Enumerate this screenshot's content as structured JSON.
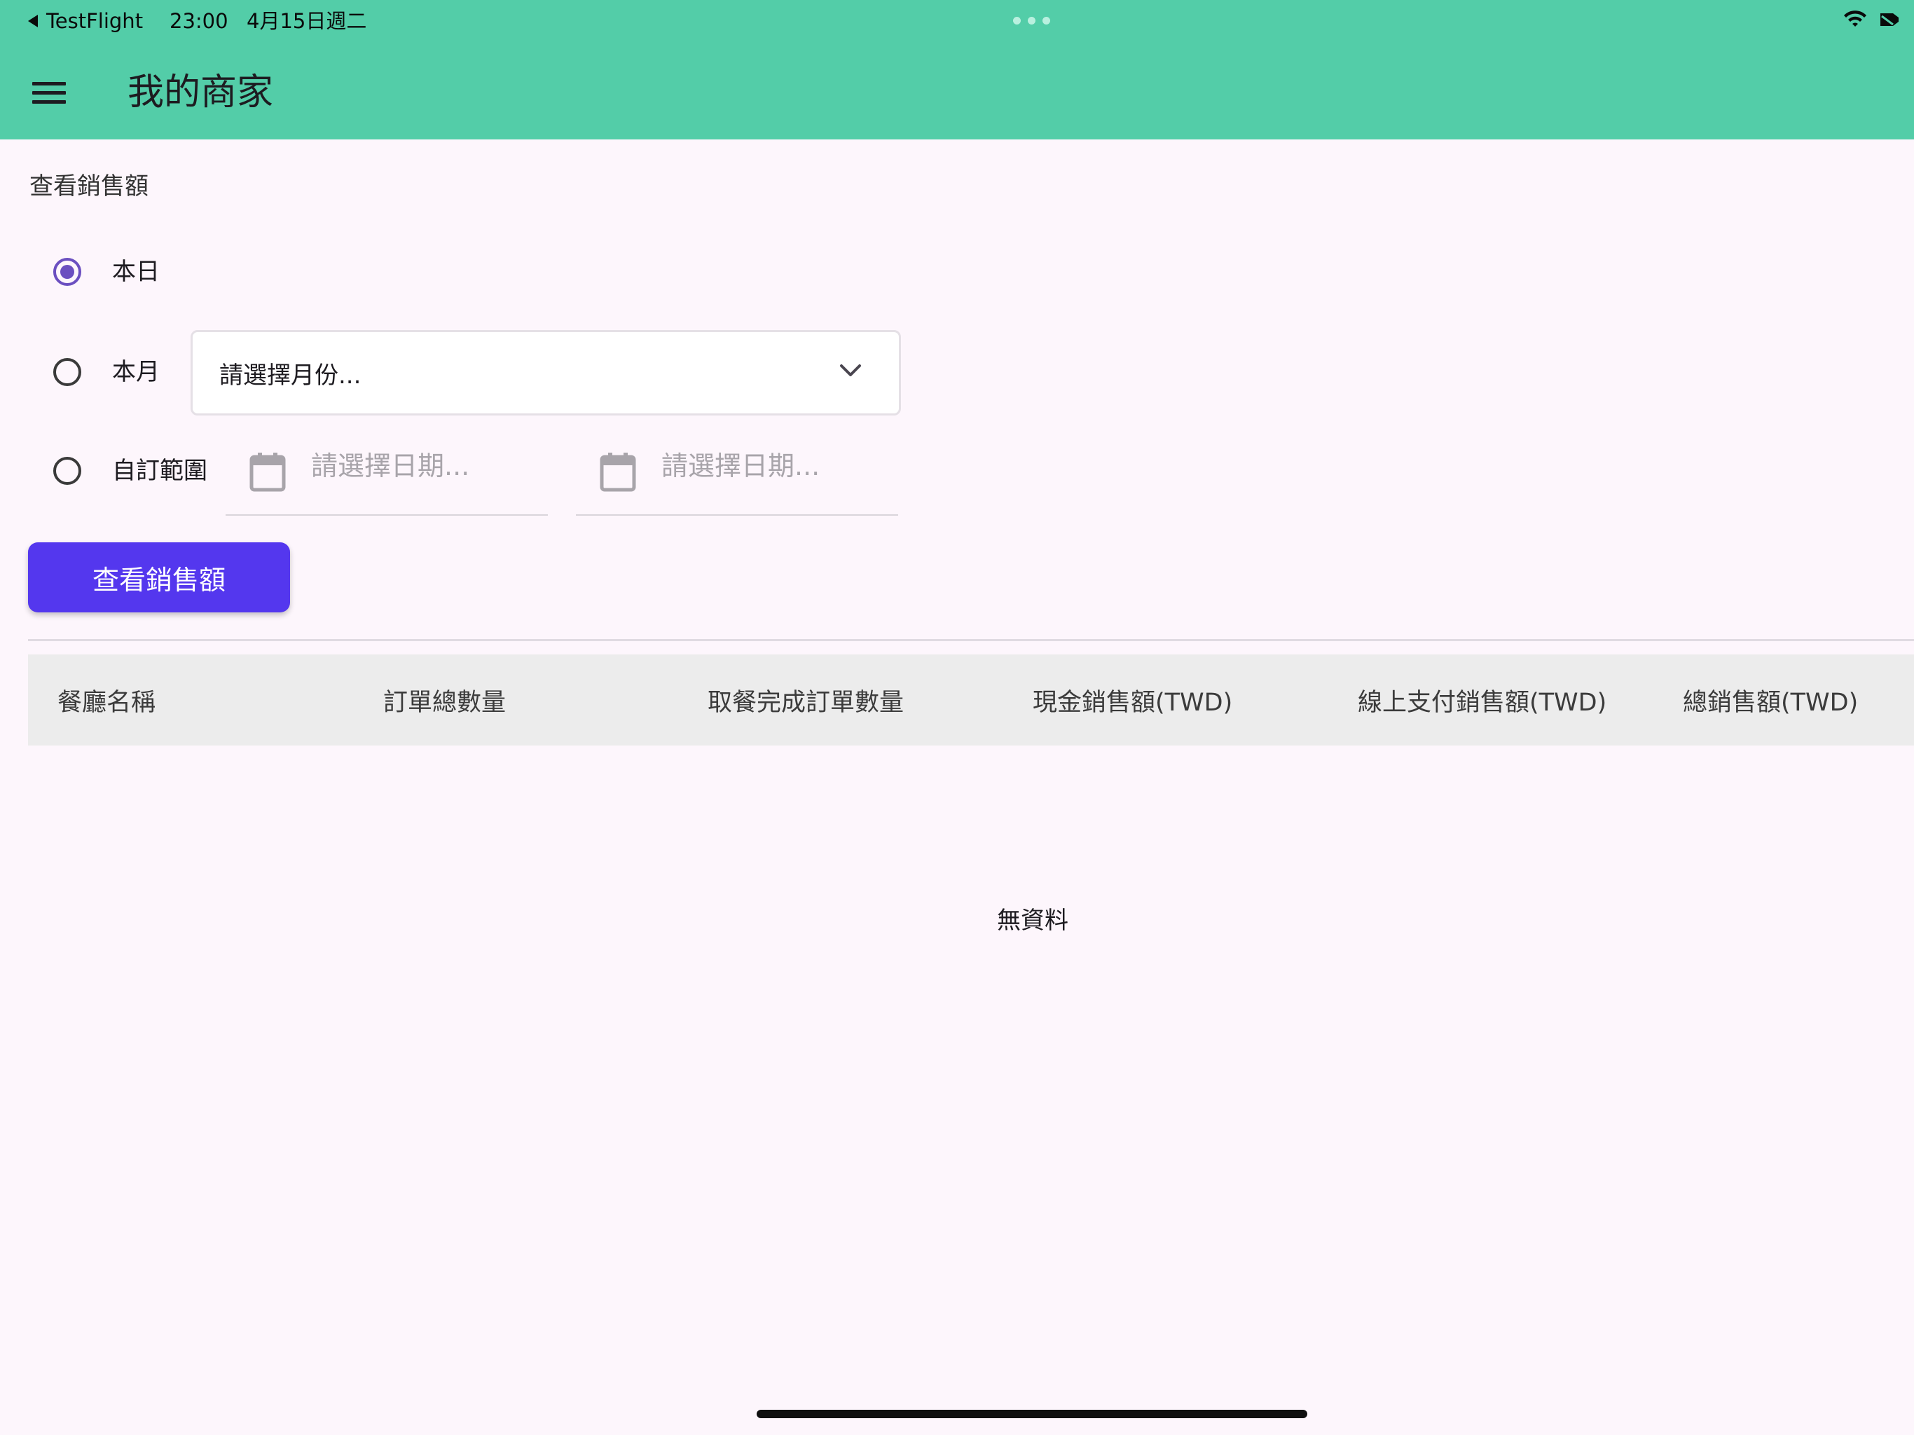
{
  "status_bar": {
    "back_app": "TestFlight",
    "time": "23:00",
    "date": "4月15日週二"
  },
  "app_bar": {
    "title": "我的商家",
    "menu_icon": "hamburger-menu-icon",
    "background_color": "#53cda8"
  },
  "filter": {
    "section_title": "查看銷售額",
    "options": [
      {
        "label": "本日",
        "selected": true
      },
      {
        "label": "本月",
        "selected": false
      },
      {
        "label": "自訂範圍",
        "selected": false
      }
    ],
    "month_select": {
      "value": "請選擇月份...",
      "icon": "chevron-down-icon"
    },
    "start_date": {
      "placeholder": "請選擇日期...",
      "icon": "calendar-icon"
    },
    "end_date": {
      "placeholder": "請選擇日期...",
      "icon": "calendar-icon"
    },
    "submit_label": "查看銷售額",
    "accent_color": "#5437ee",
    "radio_color": "#6b4fc0"
  },
  "table": {
    "columns": [
      "餐廳名稱",
      "訂單總數量",
      "取餐完成訂單數量",
      "現金銷售額(TWD)",
      "線上支付銷售額(TWD)",
      "總銷售額(TWD)"
    ],
    "rows": [],
    "empty_text": "無資料"
  }
}
